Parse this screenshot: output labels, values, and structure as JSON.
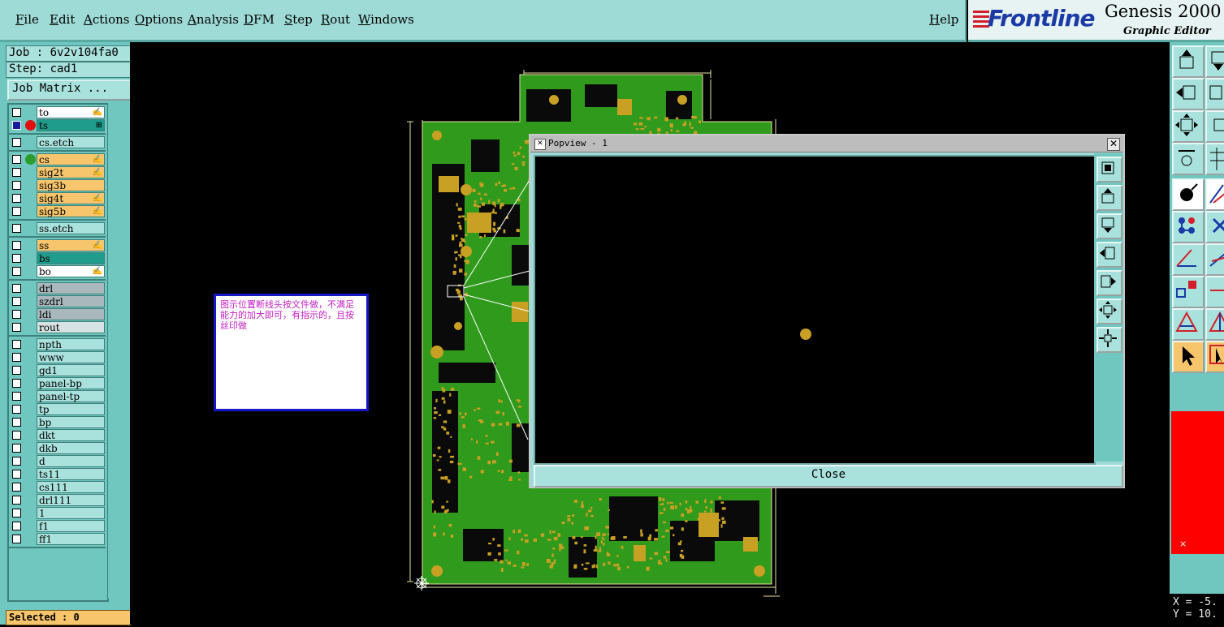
{
  "menu": {
    "items": [
      "File",
      "Edit",
      "Actions",
      "Options",
      "Analysis",
      "DFM",
      "Step",
      "Rout",
      "Windows"
    ],
    "help": "Help"
  },
  "logo": {
    "brand": "Frontline",
    "product": "Genesis 2000 ",
    "subtitle": "Graphic Editor"
  },
  "job": {
    "job_line": "Job : 6v2v104fa0",
    "step_line": "Step: cad1",
    "matrix_button": "Job Matrix ..."
  },
  "layers": [
    {
      "name": "to",
      "bg": "#ffffff",
      "edit": "✍"
    },
    {
      "name": "ts",
      "bg": "#1f9c8c",
      "edit": "⊞",
      "dot": "#e01010",
      "active": true
    },
    {
      "name": "cs.etch",
      "bg": "#a9e2dd"
    },
    {
      "name": "cs",
      "bg": "#f7c56c",
      "edit": "✍",
      "dot": "#2c9c2c"
    },
    {
      "name": "sig2t",
      "bg": "#f7c56c",
      "edit": "✍"
    },
    {
      "name": "sig3b",
      "bg": "#f7c56c"
    },
    {
      "name": "sig4t",
      "bg": "#f7c56c",
      "edit": "✍"
    },
    {
      "name": "sig5b",
      "bg": "#f7c56c",
      "edit": "✍"
    },
    {
      "name": "ss.etch",
      "bg": "#a9e2dd"
    },
    {
      "name": "ss",
      "bg": "#f7c56c",
      "edit": "✍"
    },
    {
      "name": "bs",
      "bg": "#1f9c8c"
    },
    {
      "name": "bo",
      "bg": "#ffffff",
      "edit": "✍"
    },
    {
      "name": "drl",
      "bg": "#a8b8bc"
    },
    {
      "name": "szdrl",
      "bg": "#a8b8bc"
    },
    {
      "name": "ldi",
      "bg": "#a8b8bc"
    },
    {
      "name": "rout",
      "bg": "#d7e2e3"
    },
    {
      "name": "npth",
      "bg": "#a9e2dd"
    },
    {
      "name": "www",
      "bg": "#a9e2dd"
    },
    {
      "name": "gd1",
      "bg": "#a9e2dd"
    },
    {
      "name": "panel-bp",
      "bg": "#a9e2dd"
    },
    {
      "name": "panel-tp",
      "bg": "#a9e2dd"
    },
    {
      "name": "tp",
      "bg": "#a9e2dd"
    },
    {
      "name": "bp",
      "bg": "#a9e2dd"
    },
    {
      "name": "dkt",
      "bg": "#a9e2dd"
    },
    {
      "name": "dkb",
      "bg": "#a9e2dd"
    },
    {
      "name": "d",
      "bg": "#a9e2dd"
    },
    {
      "name": "ts11",
      "bg": "#a9e2dd"
    },
    {
      "name": "cs111",
      "bg": "#a9e2dd"
    },
    {
      "name": "drl111",
      "bg": "#a9e2dd"
    },
    {
      "name": "1",
      "bg": "#a9e2dd"
    },
    {
      "name": "f1",
      "bg": "#a9e2dd"
    },
    {
      "name": "ff1",
      "bg": "#a9e2dd"
    }
  ],
  "status": {
    "selected": "Selected : 0"
  },
  "note": {
    "text": "图示位置断线头按文件做，不满足能力的加大即可，有指示的，且按丝印做"
  },
  "popview": {
    "title": "Popview - 1",
    "close_label": "Close",
    "side_buttons": [
      "zoom-fit-icon",
      "zoom-up-icon",
      "zoom-down-icon",
      "pan-left-icon",
      "pan-right-icon",
      "zoom-in-icon",
      "zoom-out-icon"
    ]
  },
  "coords": {
    "x": "X = -5.",
    "y": "Y = 10."
  },
  "colors": {
    "panel": "#9edbd6",
    "panel_dark": "#6fc7bf",
    "board_green": "#2f9a1c",
    "pad": "#c8a024",
    "note_text": "#c41fc4",
    "note_border": "#1616c8"
  }
}
